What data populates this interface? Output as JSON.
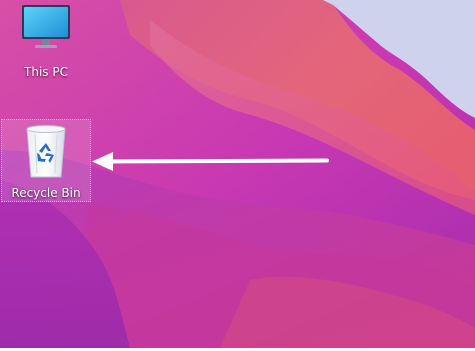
{
  "desktop": {
    "icons": [
      {
        "label": "This PC",
        "icon": "monitor-icon"
      },
      {
        "label": "Recycle Bin",
        "icon": "recycle-bin-icon",
        "selected": true
      }
    ]
  },
  "annotation": {
    "type": "arrow",
    "color": "#ffffff",
    "points_to": "Recycle Bin"
  },
  "colors": {
    "wallpaper_magenta": "#c434b0",
    "wallpaper_pink": "#e0607a",
    "wallpaper_lavender": "#cdd0ea",
    "wallpaper_purple": "#9a2ea8",
    "monitor_screen": "#39b6ea",
    "recycle_symbol": "#1e6fd8"
  }
}
